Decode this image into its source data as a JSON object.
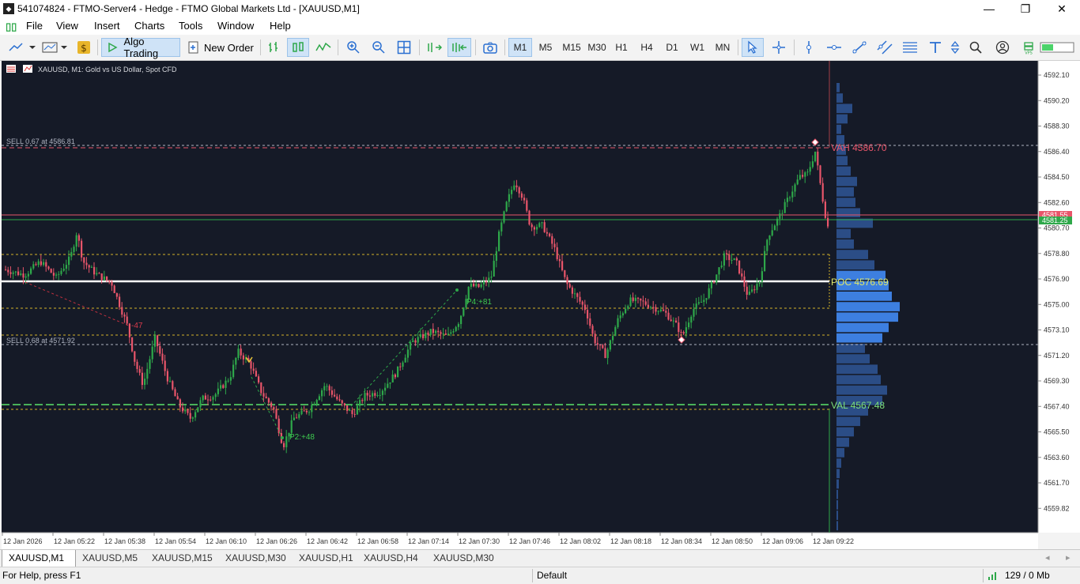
{
  "window": {
    "title": "541074824 - FTMO-Server4 - Hedge - FTMO Global Markets Ltd - [XAUUSD,M1]",
    "minimize": "—",
    "maximize": "❐",
    "close": "✕"
  },
  "menu": [
    "File",
    "View",
    "Insert",
    "Charts",
    "Tools",
    "Window",
    "Help"
  ],
  "toolbar": {
    "algo_trading": "Algo Trading",
    "new_order": "New Order",
    "timeframes": [
      "M1",
      "M5",
      "M15",
      "M30",
      "H1",
      "H4",
      "D1",
      "W1",
      "MN"
    ],
    "active_timeframe": "M1"
  },
  "chart": {
    "header": "XAUUSD, M1:  Gold vs US Dollar, Spot CFD",
    "price_labels": [
      "4592.10",
      "4590.20",
      "4588.30",
      "4586.40",
      "4584.50",
      "4582.60",
      "4580.70",
      "4578.80",
      "4576.90",
      "4575.00",
      "4573.10",
      "4571.20",
      "4569.30",
      "4567.40",
      "4565.50",
      "4563.60",
      "4561.70",
      "4559.82"
    ],
    "time_labels": [
      "12 Jan 2026",
      "12 Jan 05:22",
      "12 Jan 05:38",
      "12 Jan 05:54",
      "12 Jan 06:10",
      "12 Jan 06:26",
      "12 Jan 06:42",
      "12 Jan 06:58",
      "12 Jan 07:14",
      "12 Jan 07:30",
      "12 Jan 07:46",
      "12 Jan 08:02",
      "12 Jan 08:18",
      "12 Jan 08:34",
      "12 Jan 08:50",
      "12 Jan 09:06",
      "12 Jan 09:22"
    ],
    "bid_tag": "4581.55",
    "ask_tag": "4581.25",
    "order_line_1": "SELL 0.67 at 4586.81",
    "order_line_2": "SELL 0.68 at 4571.92",
    "vah_label": "VAH 4586.70",
    "poc_label": "POC 4576.69",
    "val_label": "VAL 4567.48",
    "marker_p2": "P2:+48",
    "marker_p4": "P4:+81",
    "marker_neg": "-47",
    "colors": {
      "background": "#151a27",
      "bull": "#2ea84a",
      "bear": "#e8556a",
      "poc": "#ffffff",
      "vah": "#e8556a",
      "val": "#59e36a",
      "profile": "#3d7fe0"
    }
  },
  "tabs": [
    "XAUUSD,M1",
    "XAUUSD,M5",
    "XAUUSD,M15",
    "XAUUSD,M30",
    "XAUUSD,H1",
    "XAUUSD,H4",
    "XAUUSD,M30"
  ],
  "status": {
    "help": "For Help, press F1",
    "profile": "Default",
    "traffic": "129 / 0 Mb"
  }
}
